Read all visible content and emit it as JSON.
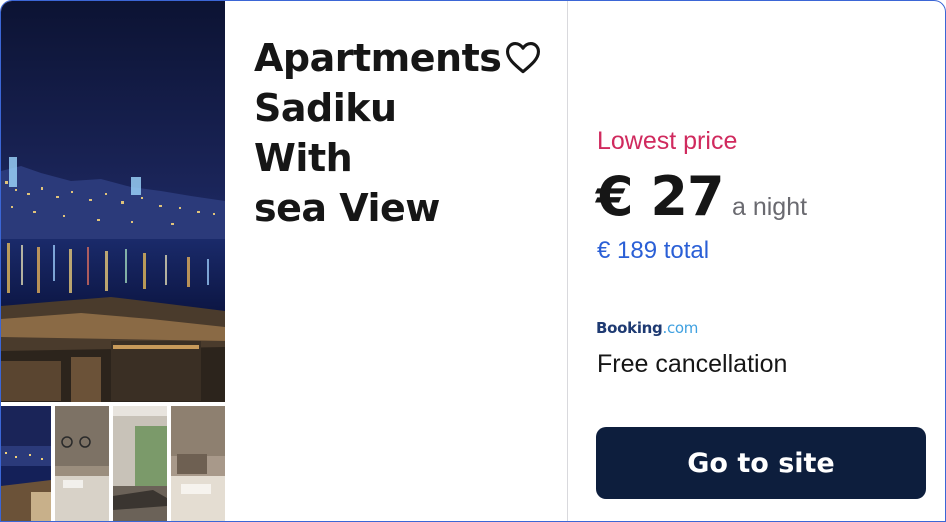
{
  "hotel": {
    "title_line1": "Apartments",
    "title_line2": "Sadiku With",
    "title_line3": "sea View"
  },
  "price": {
    "lowest_label": "Lowest price",
    "amount": "€ 27",
    "per_night": "a night",
    "total": "€ 189 total"
  },
  "provider": {
    "name": "Booking",
    "tld": ".com"
  },
  "cancellation": "Free cancellation",
  "cta": {
    "label": "Go to site"
  },
  "icons": {
    "favorite": "heart-outline-icon"
  },
  "colors": {
    "accent_border": "#3b66d6",
    "lowest_label": "#d02a5e",
    "total_link": "#2a5fd6",
    "button_bg": "#0d1e3d"
  }
}
